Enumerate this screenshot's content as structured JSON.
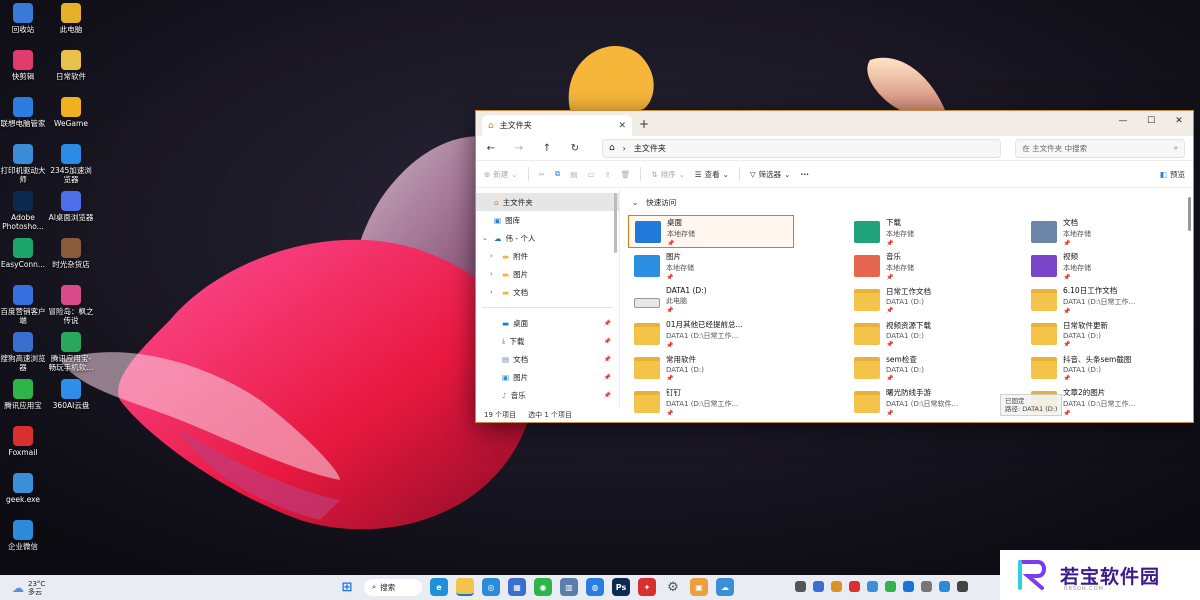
{
  "desktop": {
    "icons": [
      {
        "label": "回收站",
        "color": "#3b79d9"
      },
      {
        "label": "此电脑",
        "color": "#e5b12b"
      },
      {
        "label": "快剪辑",
        "color": "#e13b6b"
      },
      {
        "label": "日常软件",
        "color": "#e8c14a"
      },
      {
        "label": "联想电脑管家",
        "color": "#2c7de0"
      },
      {
        "label": "WeGame",
        "color": "#f0b020"
      },
      {
        "label": "打印机驱动大师",
        "color": "#3a8cd8"
      },
      {
        "label": "2345加速浏览器",
        "color": "#2b8ae3"
      },
      {
        "label": "Adobe Photosho...",
        "color": "#0c2a4f"
      },
      {
        "label": "AI桌面浏览器",
        "color": "#4d6ee8"
      },
      {
        "label": "EasyConn...",
        "color": "#1ba56b"
      },
      {
        "label": "时光杂货店",
        "color": "#8a5a3a"
      },
      {
        "label": "百度营销客户端",
        "color": "#3670e0"
      },
      {
        "label": "冒险岛：枫之传说",
        "color": "#d94c8a"
      },
      {
        "label": "搜狗高速浏览器",
        "color": "#3a6fd0"
      },
      {
        "label": "腾讯应用宝-畅玩手机软...",
        "color": "#27a85a"
      },
      {
        "label": "腾讯应用宝",
        "color": "#2fb44a"
      },
      {
        "label": "360AI云盘",
        "color": "#2f8fe8"
      },
      {
        "label": "Foxmail",
        "color": "#d8302e"
      },
      {
        "label": "geek.exe",
        "color": "#3a8fd8"
      },
      {
        "label": "企业微信",
        "color": "#2b8bda"
      }
    ]
  },
  "explorer": {
    "tab_label": "主文件夹",
    "address": "主文件夹",
    "search_placeholder": "在 主文件夹 中搜索",
    "toolbar": {
      "new_label": "新建",
      "sort_label": "排序",
      "view_label": "查看",
      "filter_label": "筛选器",
      "more_label": "···",
      "preview_label": "预览"
    },
    "sidebar": {
      "home": "主文件夹",
      "gallery": "图库",
      "onedrive": "伟 - 个人",
      "sub": [
        "附件",
        "图片",
        "文档"
      ],
      "pinned": [
        "桌面",
        "下载",
        "文档",
        "图片",
        "音乐"
      ]
    },
    "quick_access_title": "快速访问",
    "items": [
      {
        "name": "桌面",
        "sub": "本地存储",
        "icon": "desktop-folder-icon",
        "color": "#1f7ad9"
      },
      {
        "name": "下载",
        "sub": "本地存储",
        "icon": "download-folder-icon",
        "color": "#1ea37a"
      },
      {
        "name": "文档",
        "sub": "本地存储",
        "icon": "documents-folder-icon",
        "color": "#6c86a8"
      },
      {
        "name": "图片",
        "sub": "本地存储",
        "icon": "pictures-folder-icon",
        "color": "#2c8ee0"
      },
      {
        "name": "音乐",
        "sub": "本地存储",
        "icon": "music-folder-icon",
        "color": "#e8654e"
      },
      {
        "name": "视频",
        "sub": "本地存储",
        "icon": "videos-folder-icon",
        "color": "#7a45c8"
      },
      {
        "name": "DATA1 (D:)",
        "sub": "此电脑",
        "icon": "drive-icon",
        "color": "#666"
      },
      {
        "name": "日常工作文档",
        "sub": "DATA1 (D:)",
        "icon": "folder-icon",
        "color": "#f4c44a"
      },
      {
        "name": "6.10日工作文档",
        "sub": "DATA1 (D:\\日常工作...",
        "icon": "folder-icon",
        "color": "#f4c44a"
      },
      {
        "name": "01月其他已经提前总...",
        "sub": "DATA1 (D:\\日常工作...",
        "icon": "folder-icon",
        "color": "#f4c44a"
      },
      {
        "name": "视频资源下载",
        "sub": "DATA1 (D:)",
        "icon": "folder-icon",
        "color": "#f4c44a"
      },
      {
        "name": "日常软件更新",
        "sub": "DATA1 (D:)",
        "icon": "folder-icon",
        "color": "#f4c44a"
      },
      {
        "name": "常用软件",
        "sub": "DATA1 (D:)",
        "icon": "folder-icon",
        "color": "#f4c44a"
      },
      {
        "name": "sem检查",
        "sub": "DATA1 (D:)",
        "icon": "folder-icon",
        "color": "#f4c44a"
      },
      {
        "name": "抖音、头条sem截图",
        "sub": "DATA1 (D:)",
        "icon": "folder-icon",
        "color": "#f4c44a"
      },
      {
        "name": "钉钉",
        "sub": "DATA1 (D:\\日常工作...",
        "icon": "folder-icon",
        "color": "#f4c44a"
      },
      {
        "name": "曙光防线手游",
        "sub": "DATA1 (D:\\日常软件...",
        "icon": "folder-icon",
        "color": "#f4c44a"
      },
      {
        "name": "文章2的图片",
        "sub": "DATA1 (D:\\日常工作...",
        "icon": "folder-icon",
        "color": "#f4c44a"
      }
    ],
    "tooltip_line1": "已固定",
    "tooltip_line2": "路径: DATA1 (D:)",
    "status_count": "19 个项目",
    "status_selected": "选中 1 个项目"
  },
  "taskbar": {
    "temperature": "23°C",
    "weather": "多云",
    "search_label": "搜索"
  },
  "watermark": {
    "text": "若宝软件园",
    "sub": "RBSON.COM"
  }
}
